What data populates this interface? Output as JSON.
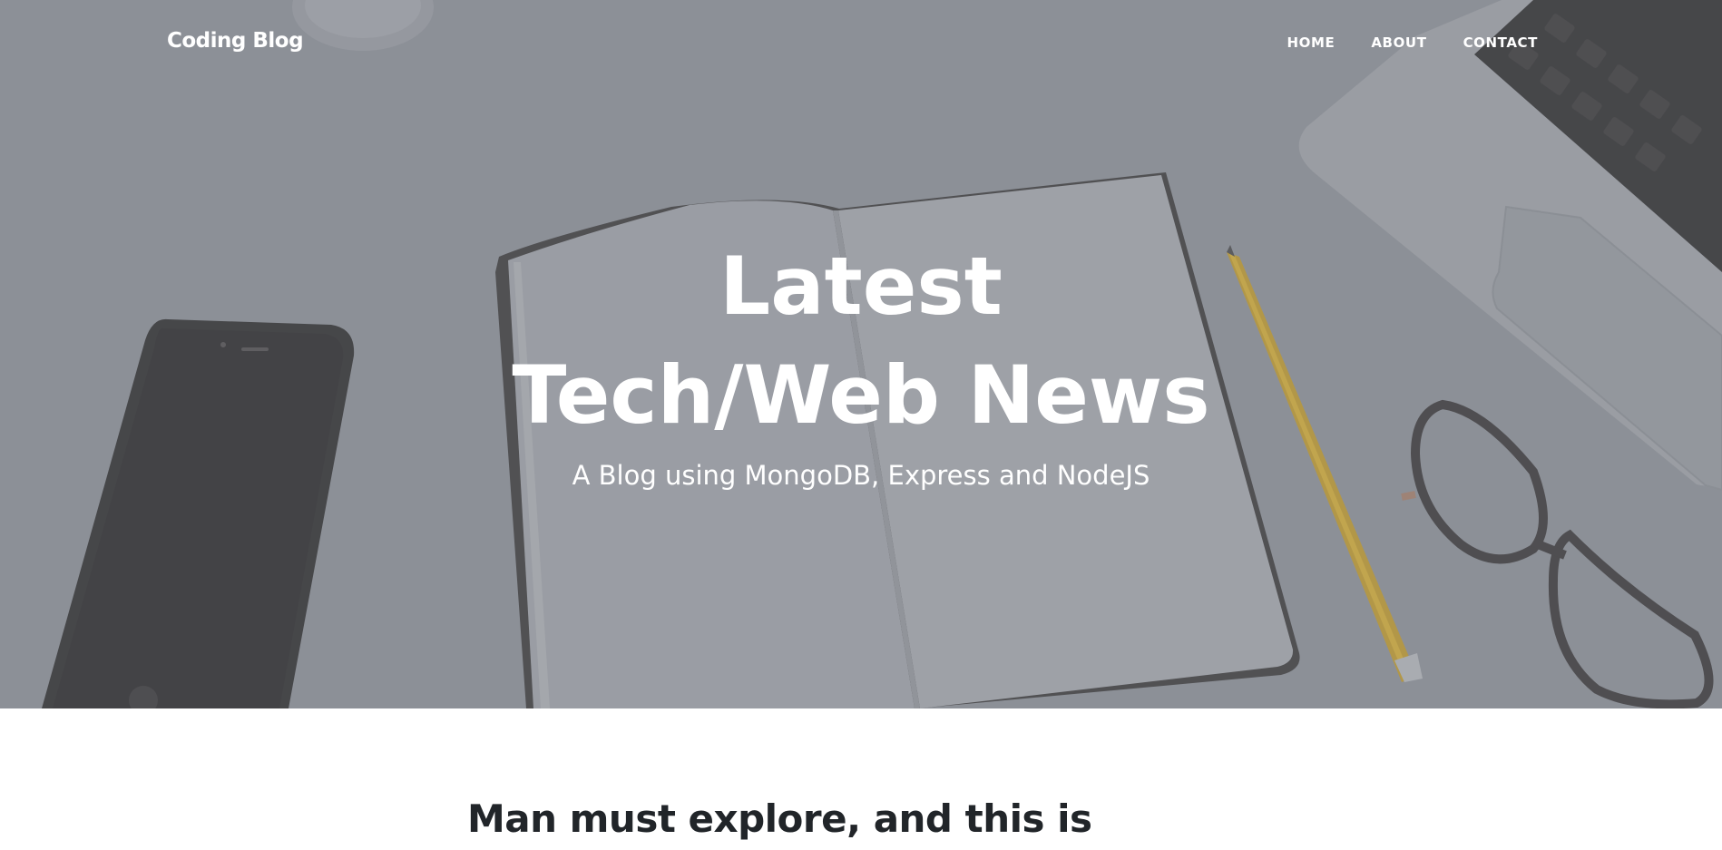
{
  "nav": {
    "brand": "Coding Blog",
    "links": [
      {
        "label": "HOME"
      },
      {
        "label": "ABOUT"
      },
      {
        "label": "CONTACT"
      }
    ]
  },
  "hero": {
    "title_line1": "Latest",
    "title_line2": "Tech/Web News",
    "subheading": "A Blog using MongoDB, Express and NodeJS"
  },
  "posts": [
    {
      "title": "Man must explore, and this is"
    }
  ],
  "colors": {
    "overlay": "#868e96",
    "text_light": "#ffffff",
    "text_dark": "#212529",
    "pencil": "#e2b126"
  }
}
